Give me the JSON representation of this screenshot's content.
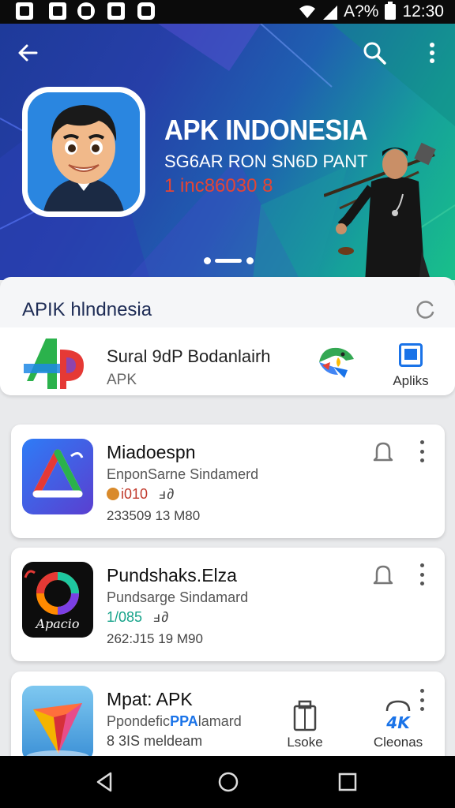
{
  "status_bar": {
    "signal_text": "A?%",
    "time": "12:30"
  },
  "hero": {
    "title": "APK INDONESIA",
    "subtitle": "SG6AR RON SN6D PANT",
    "number_line": "1 inc86030 8",
    "carousel_active": 2,
    "carousel_count": 3
  },
  "featured": {
    "heading": "APIK hlndnesia",
    "item_name": "Sural 9dP Bodanlairh",
    "item_type": "APK",
    "action_label": "Apliks"
  },
  "apps": [
    {
      "title": "Miadoespn",
      "developer": "EnponSarne Sindamerd",
      "stat": "i010",
      "stat_color": "#c0392b",
      "stat_extra": "ⅎ ∂",
      "meta": "233509 13 M80"
    },
    {
      "title": "Pundshaks.Elza",
      "developer": "Pundsarge Sindamard",
      "stat": "1/085",
      "stat_color": "#16a38a",
      "stat_extra": "ⅎ ∂",
      "meta": "262:J15 19 M90",
      "icon_text": "Apacio"
    },
    {
      "title": "Mpat: APK",
      "developer": "Ppondefic",
      "developer_overlay": "PPA",
      "developer_tail": "lamard",
      "stat": "8 3IS meldeam",
      "stat_color": "#444"
    }
  ],
  "bottom_actions": [
    {
      "label": "Lsoke",
      "icon": "clipboard-icon"
    },
    {
      "label": "Cleonas",
      "icon": "4k-icon"
    }
  ],
  "colors": {
    "accent": "#1a73e8",
    "hero_start": "#1e3a9a",
    "hero_end": "#18c08a",
    "hero_number": "#e44535"
  }
}
